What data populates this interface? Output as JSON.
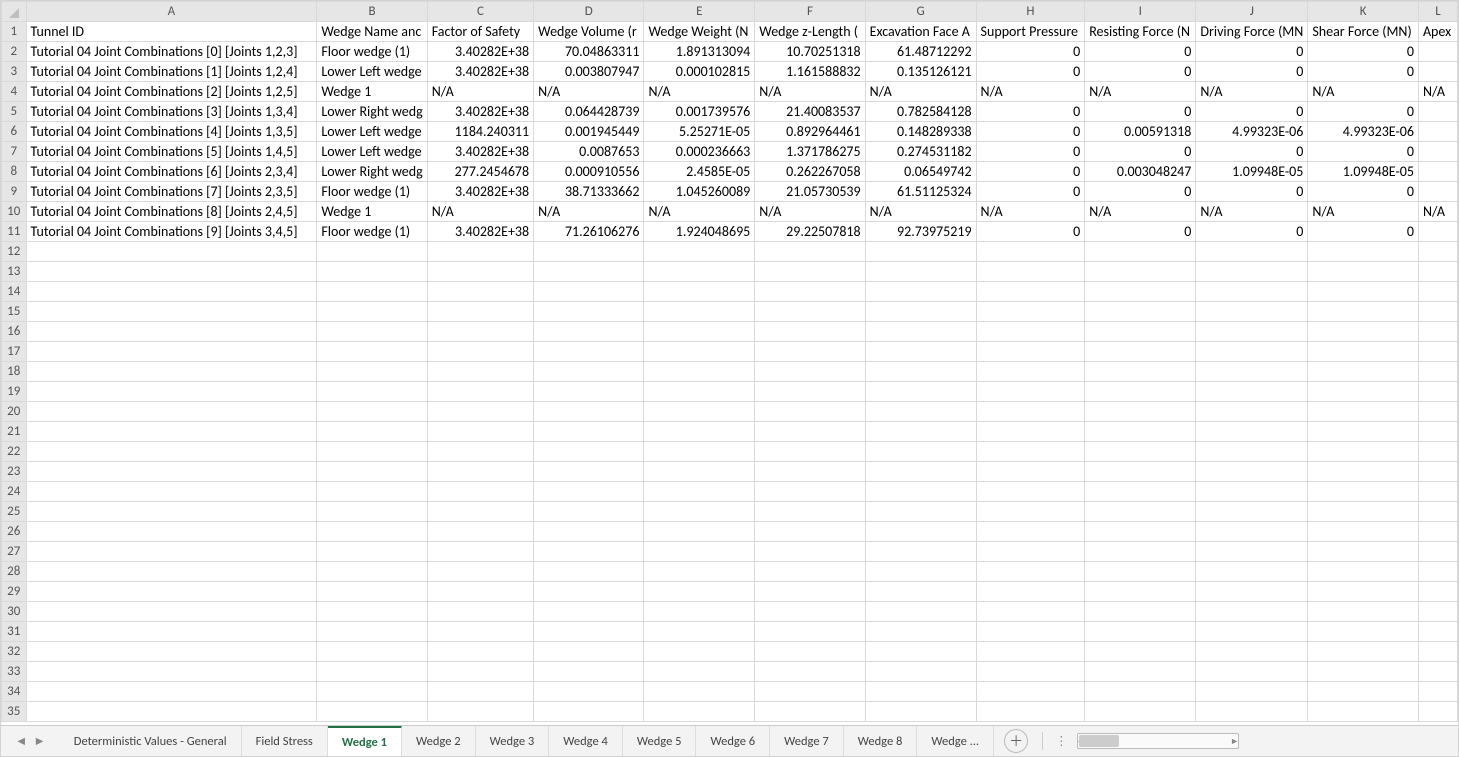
{
  "columns": [
    "A",
    "B",
    "C",
    "D",
    "E",
    "F",
    "G",
    "H",
    "I",
    "J",
    "K",
    "L"
  ],
  "col_classes": [
    "cA",
    "cB",
    "cC",
    "cD",
    "cE",
    "cF",
    "cG",
    "cH",
    "cI",
    "cJ",
    "cK",
    "cL"
  ],
  "total_rows": 35,
  "headers_row": [
    "Tunnel ID",
    "Wedge Name anc",
    "Factor of Safety",
    "Wedge Volume (r",
    "Wedge Weight (N",
    "Wedge z-Length (",
    "Excavation Face A",
    "Support Pressure",
    "Resisting Force (N",
    "Driving Force (MN",
    "Shear Force (MN)",
    "Apex"
  ],
  "rows": [
    {
      "A": "Tutorial 04 Joint Combinations [0] [Joints 1,2,3]",
      "B": "Floor wedge (1)",
      "C": "3.40282E+38",
      "D": "70.04863311",
      "E": "1.891313094",
      "F": "10.70251318",
      "G": "61.48712292",
      "H": "0",
      "I": "0",
      "J": "0",
      "K": "0",
      "L": ""
    },
    {
      "A": "Tutorial 04 Joint Combinations [1] [Joints 1,2,4]",
      "B": "Lower Left wedge",
      "C": "3.40282E+38",
      "D": "0.003807947",
      "E": "0.000102815",
      "F": "1.161588832",
      "G": "0.135126121",
      "H": "0",
      "I": "0",
      "J": "0",
      "K": "0",
      "L": ""
    },
    {
      "A": "Tutorial 04 Joint Combinations [2] [Joints 1,2,5]",
      "B": "Wedge 1",
      "C": "N/A",
      "D": "N/A",
      "E": "N/A",
      "F": "N/A",
      "G": "N/A",
      "H": "N/A",
      "I": "N/A",
      "J": "N/A",
      "K": "N/A",
      "L": "N/A"
    },
    {
      "A": "Tutorial 04 Joint Combinations [3] [Joints 1,3,4]",
      "B": "Lower Right wedg",
      "C": "3.40282E+38",
      "D": "0.064428739",
      "E": "0.001739576",
      "F": "21.40083537",
      "G": "0.782584128",
      "H": "0",
      "I": "0",
      "J": "0",
      "K": "0",
      "L": ""
    },
    {
      "A": "Tutorial 04 Joint Combinations [4] [Joints 1,3,5]",
      "B": "Lower Left wedge",
      "C": "1184.240311",
      "D": "0.001945449",
      "E": "5.25271E-05",
      "F": "0.892964461",
      "G": "0.148289338",
      "H": "0",
      "I": "0.00591318",
      "J": "4.99323E-06",
      "K": "4.99323E-06",
      "L": ""
    },
    {
      "A": "Tutorial 04 Joint Combinations [5] [Joints 1,4,5]",
      "B": "Lower Left wedge",
      "C": "3.40282E+38",
      "D": "0.0087653",
      "E": "0.000236663",
      "F": "1.371786275",
      "G": "0.274531182",
      "H": "0",
      "I": "0",
      "J": "0",
      "K": "0",
      "L": ""
    },
    {
      "A": "Tutorial 04 Joint Combinations [6] [Joints 2,3,4]",
      "B": "Lower Right wedg",
      "C": "277.2454678",
      "D": "0.000910556",
      "E": "2.4585E-05",
      "F": "0.262267058",
      "G": "0.06549742",
      "H": "0",
      "I": "0.003048247",
      "J": "1.09948E-05",
      "K": "1.09948E-05",
      "L": ""
    },
    {
      "A": "Tutorial 04 Joint Combinations [7] [Joints 2,3,5]",
      "B": "Floor wedge (1)",
      "C": "3.40282E+38",
      "D": "38.71333662",
      "E": "1.045260089",
      "F": "21.05730539",
      "G": "61.51125324",
      "H": "0",
      "I": "0",
      "J": "0",
      "K": "0",
      "L": ""
    },
    {
      "A": "Tutorial 04 Joint Combinations [8] [Joints 2,4,5]",
      "B": "Wedge 1",
      "C": "N/A",
      "D": "N/A",
      "E": "N/A",
      "F": "N/A",
      "G": "N/A",
      "H": "N/A",
      "I": "N/A",
      "J": "N/A",
      "K": "N/A",
      "L": "N/A"
    },
    {
      "A": "Tutorial 04 Joint Combinations [9] [Joints 3,4,5]",
      "B": "Floor wedge (1)",
      "C": "3.40282E+38",
      "D": "71.26106276",
      "E": "1.924048695",
      "F": "29.22507818",
      "G": "92.73975219",
      "H": "0",
      "I": "0",
      "J": "0",
      "K": "0",
      "L": ""
    }
  ],
  "text_cols": [
    "A",
    "B"
  ],
  "sheets": {
    "list": [
      "Deterministic Values - General",
      "Field Stress",
      "Wedge 1",
      "Wedge 2",
      "Wedge 3",
      "Wedge 4",
      "Wedge 5",
      "Wedge 6",
      "Wedge 7",
      "Wedge 8",
      "Wedge ..."
    ],
    "active": "Wedge 1"
  },
  "colors": {
    "accent": "#217346"
  }
}
